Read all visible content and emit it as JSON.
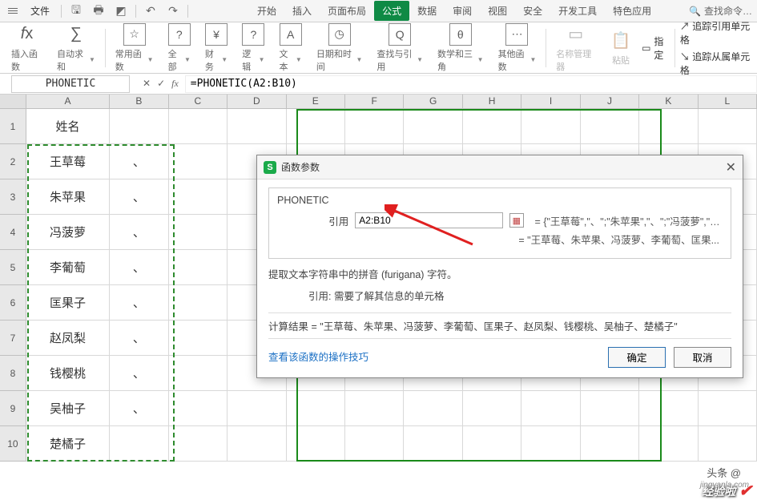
{
  "titlebar": {
    "file_label": "文件",
    "search_placeholder": "查找命令…"
  },
  "menu": {
    "tabs": [
      "开始",
      "插入",
      "页面布局",
      "公式",
      "数据",
      "审阅",
      "视图",
      "安全",
      "开发工具",
      "特色应用"
    ],
    "active_index": 3
  },
  "ribbon": {
    "insert_fn": "插入函数",
    "autosum": "自动求和",
    "common": "常用函数",
    "all": "全部",
    "finance": "财务",
    "logic": "逻辑",
    "text": "文本",
    "datetime": "日期和时间",
    "lookup": "查找与引用",
    "math": "数学和三角",
    "more": "其他函数",
    "name_mgr": "名称管理器",
    "paste": "粘贴",
    "ref_label": "指定",
    "trace_precedents": "追踪引用单元格",
    "trace_dependents": "追踪从属单元格"
  },
  "formula_bar": {
    "name_box": "PHONETIC",
    "formula": "=PHONETIC(A2:B10)"
  },
  "columns": [
    "A",
    "B",
    "C",
    "D",
    "E",
    "F",
    "G",
    "H",
    "I",
    "J",
    "K",
    "L"
  ],
  "rows": [
    {
      "n": "1",
      "a": "姓名",
      "b": ""
    },
    {
      "n": "2",
      "a": "王草莓",
      "b": "、"
    },
    {
      "n": "3",
      "a": "朱苹果",
      "b": "、"
    },
    {
      "n": "4",
      "a": "冯菠萝",
      "b": "、"
    },
    {
      "n": "5",
      "a": "李葡萄",
      "b": "、"
    },
    {
      "n": "6",
      "a": "匡果子",
      "b": "、"
    },
    {
      "n": "7",
      "a": "赵凤梨",
      "b": "、"
    },
    {
      "n": "8",
      "a": "钱樱桃",
      "b": "、"
    },
    {
      "n": "9",
      "a": "吴柚子",
      "b": "、"
    },
    {
      "n": "10",
      "a": "楚橘子",
      "b": ""
    }
  ],
  "dialog": {
    "title": "函数参数",
    "function_name": "PHONETIC",
    "arg_label": "引用",
    "arg_value": "A2:B10",
    "arg_preview": "= {\"王草莓\",\"、\";\"朱苹果\",\"、\";\"冯菠萝\",\"、...",
    "value_preview": "= \"王草莓、朱苹果、冯菠萝、李葡萄、匡果...",
    "desc1": "提取文本字符串中的拼音 (furigana) 字符。",
    "desc2_label": "引用:",
    "desc2_text": "需要了解其信息的单元格",
    "result_label": "计算结果 =",
    "result_value": "\"王草莓、朱苹果、冯菠萝、李葡萄、匡果子、赵凤梨、钱樱桃、吴柚子、楚橘子\"",
    "help_link": "查看该函数的操作技巧",
    "ok": "确定",
    "cancel": "取消"
  },
  "watermark": {
    "line1": "头条 @",
    "line2": "经验啦",
    "site": "jingyanla.com"
  }
}
